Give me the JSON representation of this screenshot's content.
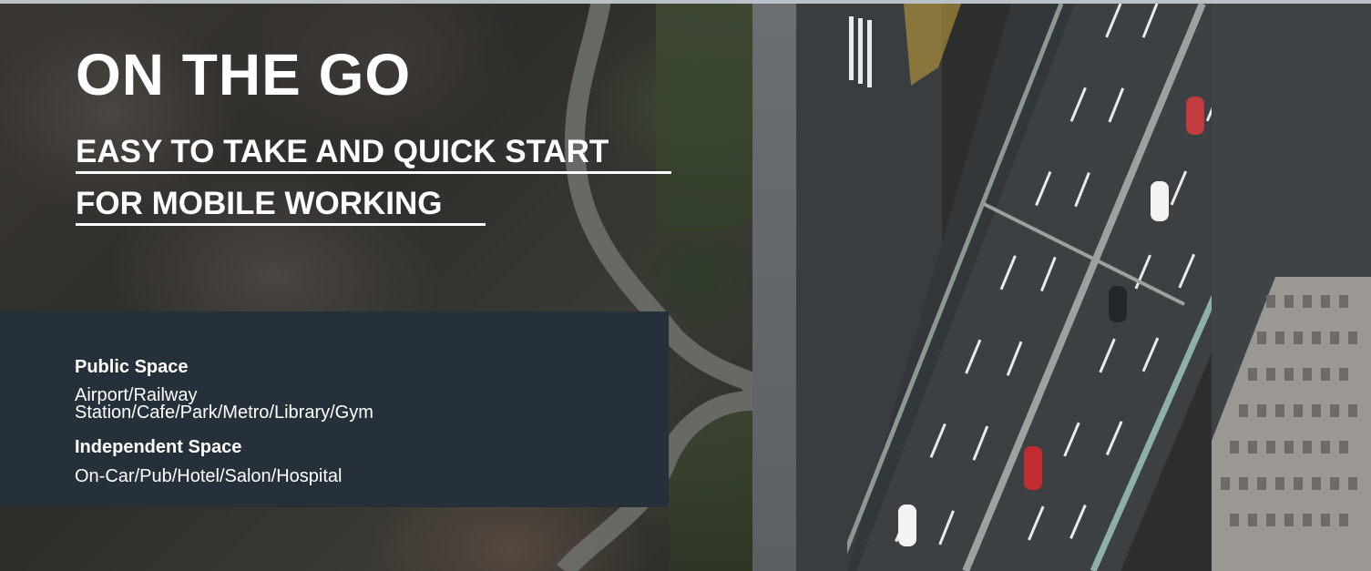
{
  "hero": {
    "title": "ON THE GO",
    "subtitle_line1": "EASY TO TAKE AND QUICK START",
    "subtitle_line2": "FOR MOBILE WORKING"
  },
  "panel": {
    "public_heading": "Public Space",
    "public_text": "Airport/Railway Station/Cafe/Park/Metro/Library/Gym",
    "independent_heading": "Independent Space",
    "independent_text": "On-Car/Pub/Hotel/Salon/Hospital"
  },
  "colors": {
    "panel_bg": "#25303a",
    "text": "#ffffff",
    "road": "#3a3d40"
  }
}
